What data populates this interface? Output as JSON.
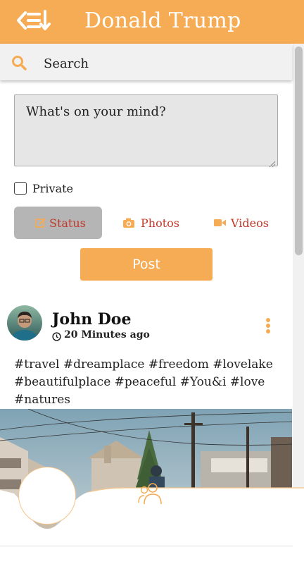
{
  "header": {
    "title": "Donald Trump",
    "back_icon": "back-list-icon"
  },
  "search": {
    "label": "Search",
    "icon": "search-icon"
  },
  "composer": {
    "placeholder": "What's on your mind?",
    "private_label": "Private",
    "private_checked": false,
    "tabs": [
      {
        "label": "Status",
        "icon": "edit-icon",
        "active": true
      },
      {
        "label": "Photos",
        "icon": "camera-icon",
        "active": false
      },
      {
        "label": "Videos",
        "icon": "video-icon",
        "active": false
      }
    ],
    "post_label": "Post"
  },
  "feed": {
    "post": {
      "author": "John Doe",
      "time": "20 Minutes ago",
      "tags": "#travel #dreamplace #freedom #lovelake #beautifulplace #peaceful #You&i #love #natures"
    }
  },
  "colors": {
    "accent": "#f5ac55",
    "tab_text": "#c0392b",
    "active_tab_bg": "#b5b5b5"
  }
}
